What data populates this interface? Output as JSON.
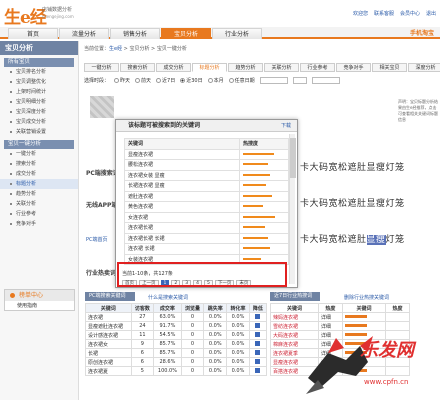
{
  "header": {
    "logo": "生e经",
    "logo_sub": "店铺数据分析",
    "logo_sub2": "shengejing.com",
    "links": [
      "欢迎您",
      "联系客服",
      "会员中心",
      "退出"
    ]
  },
  "nav": {
    "tabs": [
      "首页",
      "流量分析",
      "销售分析",
      "宝贝分析",
      "行业分析"
    ],
    "active_tab": "宝贝分析",
    "right_label": "手机淘宝"
  },
  "sidebar": {
    "title": "宝贝分析",
    "groups": [
      {
        "label": "所有宝贝",
        "items": [
          "宝贝排名分析",
          "宝贝调整优化",
          "上架时间统计",
          "宝贝明细分析",
          "宝贝深度分析",
          "宝贝成交分析",
          "关联营销设置"
        ]
      },
      {
        "label": "宝贝一键分析",
        "items": [
          "一键分析",
          "搜索分析",
          "成交分析",
          "标题分析",
          "趋势分析",
          "关联分析",
          "行业参考",
          "竞争对手"
        ]
      }
    ],
    "active_item": "标题分析",
    "favorites": {
      "title": "榜单中心",
      "item": "使用指南"
    }
  },
  "main": {
    "breadcrumb": [
      "当前位置：",
      "生e经",
      " > 宝贝分析 > ",
      "宝贝一键分析"
    ],
    "subtabs": [
      "一键分析",
      "搜索分析",
      "成交分析",
      "标题分析",
      "趋势分析",
      "关联分析",
      "行业参考",
      "竞争对手",
      "相关宝贝",
      "深度分析"
    ],
    "active_subtab": "标题分析",
    "time_label": "选择时段：",
    "time_options": [
      "昨天",
      "前天",
      "近7日",
      "近30日",
      "本月",
      "任意日期"
    ],
    "time_selected": "近30日",
    "right_note": "声明：宝贝标题分析结果由生e经推荐，点击可查看相关关键词标题信息",
    "pc_label_1": "PC端搜索词",
    "pc_label_2": "无线APP端",
    "pc_label_3": "PC端首页",
    "pc_label_4": "行业热卖词",
    "keyword_line_1": "卡大码宽松遮肚显瘦灯笼",
    "keyword_line_2": "卡大码宽松遮肚显瘦灯笼",
    "keyword_line_3": "卡大码宽松遮肚显瘦灯笼",
    "keyword_highlight": "显瘦"
  },
  "bottom_table": {
    "title": "PC端搜索关键词",
    "link": "什么是搜索关键词",
    "headers": [
      "关键词",
      "访客数",
      "成交率",
      "浏览量",
      "跳失率",
      "转化率",
      "降低"
    ],
    "rows": [
      [
        "连衣裙",
        "27",
        "63.0%",
        "0",
        "0.0%",
        "0.0%"
      ],
      [
        "显瘦遮肚连衣裙",
        "24",
        "91.7%",
        "0",
        "0.0%",
        "0.0%"
      ],
      [
        "设计感连衣裙",
        "11",
        "54.5%",
        "0",
        "0.0%",
        "0.0%"
      ],
      [
        "连衣裙女",
        "9",
        "85.7%",
        "0",
        "0.0%",
        "0.0%"
      ],
      [
        "长裙",
        "6",
        "85.7%",
        "0",
        "0.0%",
        "0.0%"
      ],
      [
        "原创连衣裙",
        "6",
        "28.6%",
        "0",
        "0.0%",
        "0.0%"
      ],
      [
        "连衣裙夏",
        "5",
        "100.0%",
        "0",
        "0.0%",
        "0.0%"
      ]
    ]
  },
  "right_table": {
    "title": "近7日行业热搜词",
    "link": "删除行业热搜关键词",
    "headers": [
      "关键词",
      "热度",
      "关键词",
      "热度"
    ],
    "rows": [
      [
        "辣妈连衣裙",
        "详细"
      ],
      [
        "雪纺连衣裙",
        "详细"
      ],
      [
        "大码连衣裙",
        "详细"
      ],
      [
        "棉麻连衣裙",
        "详细"
      ],
      [
        "连衣裙夏季",
        "详细"
      ],
      [
        "显瘦连衣裙",
        "详细"
      ],
      [
        "百搭连衣裙",
        "详细"
      ]
    ]
  },
  "modal": {
    "title": "该标题可被搜索到的关键词",
    "close": "下载",
    "headers": [
      "关键词",
      "热搜度"
    ],
    "rows": [
      {
        "kw": "显瘦连衣裙",
        "heat": 0.85
      },
      {
        "kw": "腰松连衣裙",
        "heat": 0.7
      },
      {
        "kw": "连衣裙女装 显瘦",
        "heat": 0.75
      },
      {
        "kw": "长裙连衣裙 显瘦",
        "heat": 0.65
      },
      {
        "kw": "遮肚连衣裙",
        "heat": 0.8
      },
      {
        "kw": "黄色连衣裙",
        "heat": 0.55
      },
      {
        "kw": "女连衣裙",
        "heat": 0.9
      },
      {
        "kw": "连衣裙长裙",
        "heat": 0.6
      },
      {
        "kw": "连衣裙长裙 长裙",
        "heat": 0.7
      },
      {
        "kw": "连衣裙 长裙",
        "heat": 0.75
      },
      {
        "kw": "女装连衣裙",
        "heat": 0.5
      }
    ],
    "pager": {
      "summary": "当前1-10条，共127条",
      "first": "首页",
      "prev": "上一页",
      "pages": [
        "1",
        "2",
        "3",
        "4",
        "5"
      ],
      "current": "1",
      "next": "下一页",
      "last": "末页"
    }
  },
  "watermark": {
    "text": "乐发网",
    "url": "www.cpfn.cn"
  }
}
